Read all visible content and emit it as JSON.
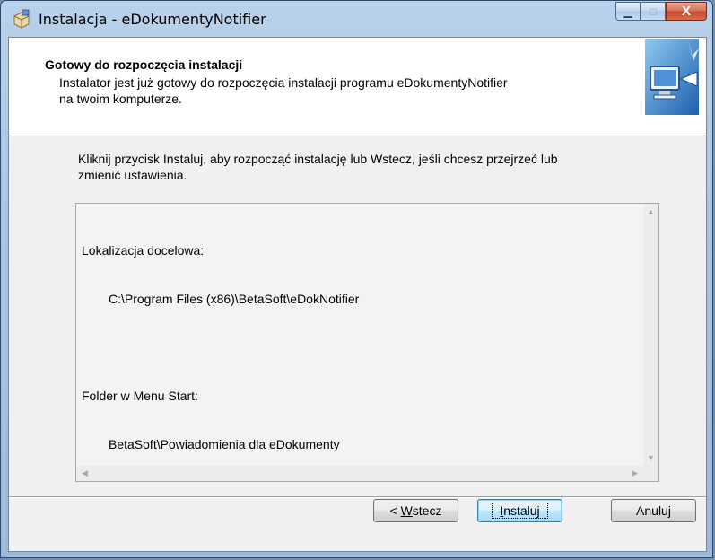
{
  "window": {
    "title": "Instalacja - eDokumentyNotifier",
    "caption": {
      "minimize": "▁",
      "maximize": "□",
      "close": "X"
    }
  },
  "header": {
    "title": "Gotowy do rozpoczęcia instalacji",
    "subtitle_line1": "Instalator jest już gotowy do rozpoczęcia instalacji programu eDokumentyNotifier",
    "subtitle_line2": "na twoim komputerze."
  },
  "description": {
    "line1": "Kliknij przycisk Instaluj, aby rozpocząć instalację lub Wstecz, jeśli chcesz przejrzeć lub",
    "line2": "zmienić ustawienia."
  },
  "summary": {
    "dest_label": "Lokalizacja docelowa:",
    "dest_value": "C:\\Program Files (x86)\\BetaSoft\\eDokNotifier",
    "menu_label": "Folder w Menu Start:",
    "menu_value": "BetaSoft\\Powiadomienia dla eDokumenty"
  },
  "buttons": {
    "back_prefix": "< ",
    "back_hotkey": "W",
    "back_rest": "stecz",
    "install_hotkey": "I",
    "install_rest": "nstaluj",
    "cancel": "Anuluj"
  },
  "icons": {
    "title": "installer-box-icon",
    "header": "computer-install-arrow-icon"
  },
  "colors": {
    "accent": "#3c7fb1",
    "close": "#c74a2c",
    "header_bg": "#ffffff",
    "body_bg": "#f0f0f0"
  }
}
